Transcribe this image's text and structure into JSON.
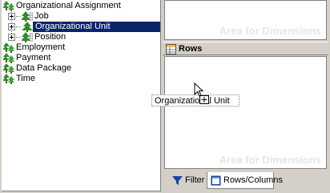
{
  "tree": {
    "items": [
      {
        "label": "Organizational Assignment"
      },
      {
        "label": "Job"
      },
      {
        "label": "Organizational Unit"
      },
      {
        "label": "Position"
      },
      {
        "label": "Employment"
      },
      {
        "label": "Payment"
      },
      {
        "label": "Data Package"
      },
      {
        "label": "Time"
      }
    ],
    "selected_index": 2
  },
  "right": {
    "top_area_watermark": "Area for Dimensions",
    "rows_header": "Rows",
    "bottom_area_watermark": "Area for Dimensions"
  },
  "drag": {
    "ghost_label": "Organizational Unit"
  },
  "tabs": [
    {
      "label": "Filter",
      "active": false
    },
    {
      "label": "Rows/Columns",
      "active": true
    }
  ],
  "colors": {
    "selection": "#0a246a",
    "tree_icon": "#2e8b2e",
    "watermark": "#e6e6e6"
  }
}
